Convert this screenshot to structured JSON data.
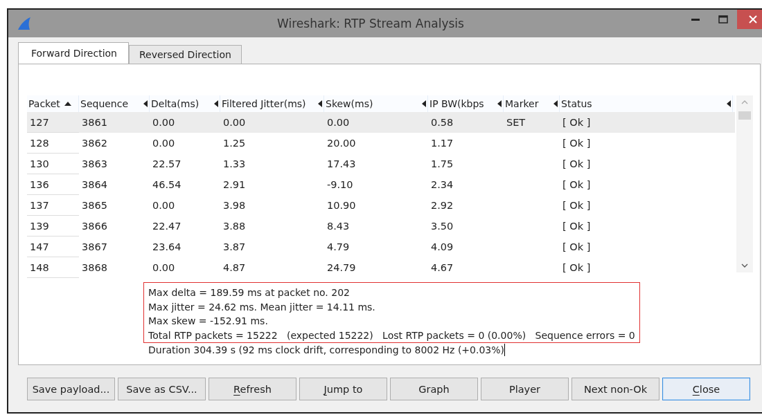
{
  "window": {
    "title": "Wireshark: RTP Stream Analysis"
  },
  "tabs": [
    {
      "label": "Forward Direction",
      "selected": true
    },
    {
      "label": "Reversed Direction",
      "selected": false
    }
  ],
  "table": {
    "columns": [
      {
        "label": "Packet",
        "sorted": true
      },
      {
        "label": "Sequence",
        "sorted": false
      },
      {
        "label": "Delta(ms)",
        "sorted": false
      },
      {
        "label": "Filtered Jitter(ms)",
        "sorted": false
      },
      {
        "label": "Skew(ms)",
        "sorted": false
      },
      {
        "label": "IP BW(kbps",
        "sorted": false
      },
      {
        "label": "Marker",
        "sorted": false
      },
      {
        "label": "Status",
        "sorted": false
      }
    ],
    "rows": [
      {
        "selected": true,
        "cells": [
          "127",
          "3861",
          "0.00",
          "0.00",
          "0.00",
          "0.58",
          "SET",
          "[ Ok ]"
        ]
      },
      {
        "selected": false,
        "cells": [
          "128",
          "3862",
          "0.00",
          "1.25",
          "20.00",
          "1.17",
          "",
          "[ Ok ]"
        ]
      },
      {
        "selected": false,
        "cells": [
          "130",
          "3863",
          "22.57",
          "1.33",
          "17.43",
          "1.75",
          "",
          "[ Ok ]"
        ]
      },
      {
        "selected": false,
        "cells": [
          "136",
          "3864",
          "46.54",
          "2.91",
          "-9.10",
          "2.34",
          "",
          "[ Ok ]"
        ]
      },
      {
        "selected": false,
        "cells": [
          "137",
          "3865",
          "0.00",
          "3.98",
          "10.90",
          "2.92",
          "",
          "[ Ok ]"
        ]
      },
      {
        "selected": false,
        "cells": [
          "139",
          "3866",
          "22.47",
          "3.88",
          "8.43",
          "3.50",
          "",
          "[ Ok ]"
        ]
      },
      {
        "selected": false,
        "cells": [
          "147",
          "3867",
          "23.64",
          "3.87",
          "4.79",
          "4.09",
          "",
          "[ Ok ]"
        ]
      },
      {
        "selected": false,
        "cells": [
          "148",
          "3868",
          "0.00",
          "4.87",
          "24.79",
          "4.67",
          "",
          "[ Ok ]"
        ]
      }
    ]
  },
  "summary": {
    "highlighted_lines": [
      "Max delta = 189.59 ms at packet no. 202",
      "Max jitter = 24.62 ms. Mean jitter = 14.11 ms.",
      "Max skew = -152.91 ms.",
      "Total RTP packets = 15222   (expected 15222)   Lost RTP packets = 0 (0.00%)   Sequence errors = 0"
    ],
    "lines": [
      "Duration 304.39 s (92 ms clock drift, corresponding to 8002 Hz (+0.03%)"
    ]
  },
  "buttons": [
    {
      "label": "Save payload...",
      "mnemonic": false,
      "default": false
    },
    {
      "label": "Save as CSV...",
      "mnemonic": false,
      "default": false
    },
    {
      "label": "Refresh",
      "mnemonic": true,
      "default": false
    },
    {
      "label": "Jump to",
      "mnemonic": true,
      "default": false
    },
    {
      "label": "Graph",
      "mnemonic": false,
      "default": false
    },
    {
      "label": "Player",
      "mnemonic": false,
      "default": false
    },
    {
      "label": "Next non-Ok",
      "mnemonic": false,
      "default": false
    },
    {
      "label": "Close",
      "mnemonic": true,
      "default": true
    }
  ]
}
